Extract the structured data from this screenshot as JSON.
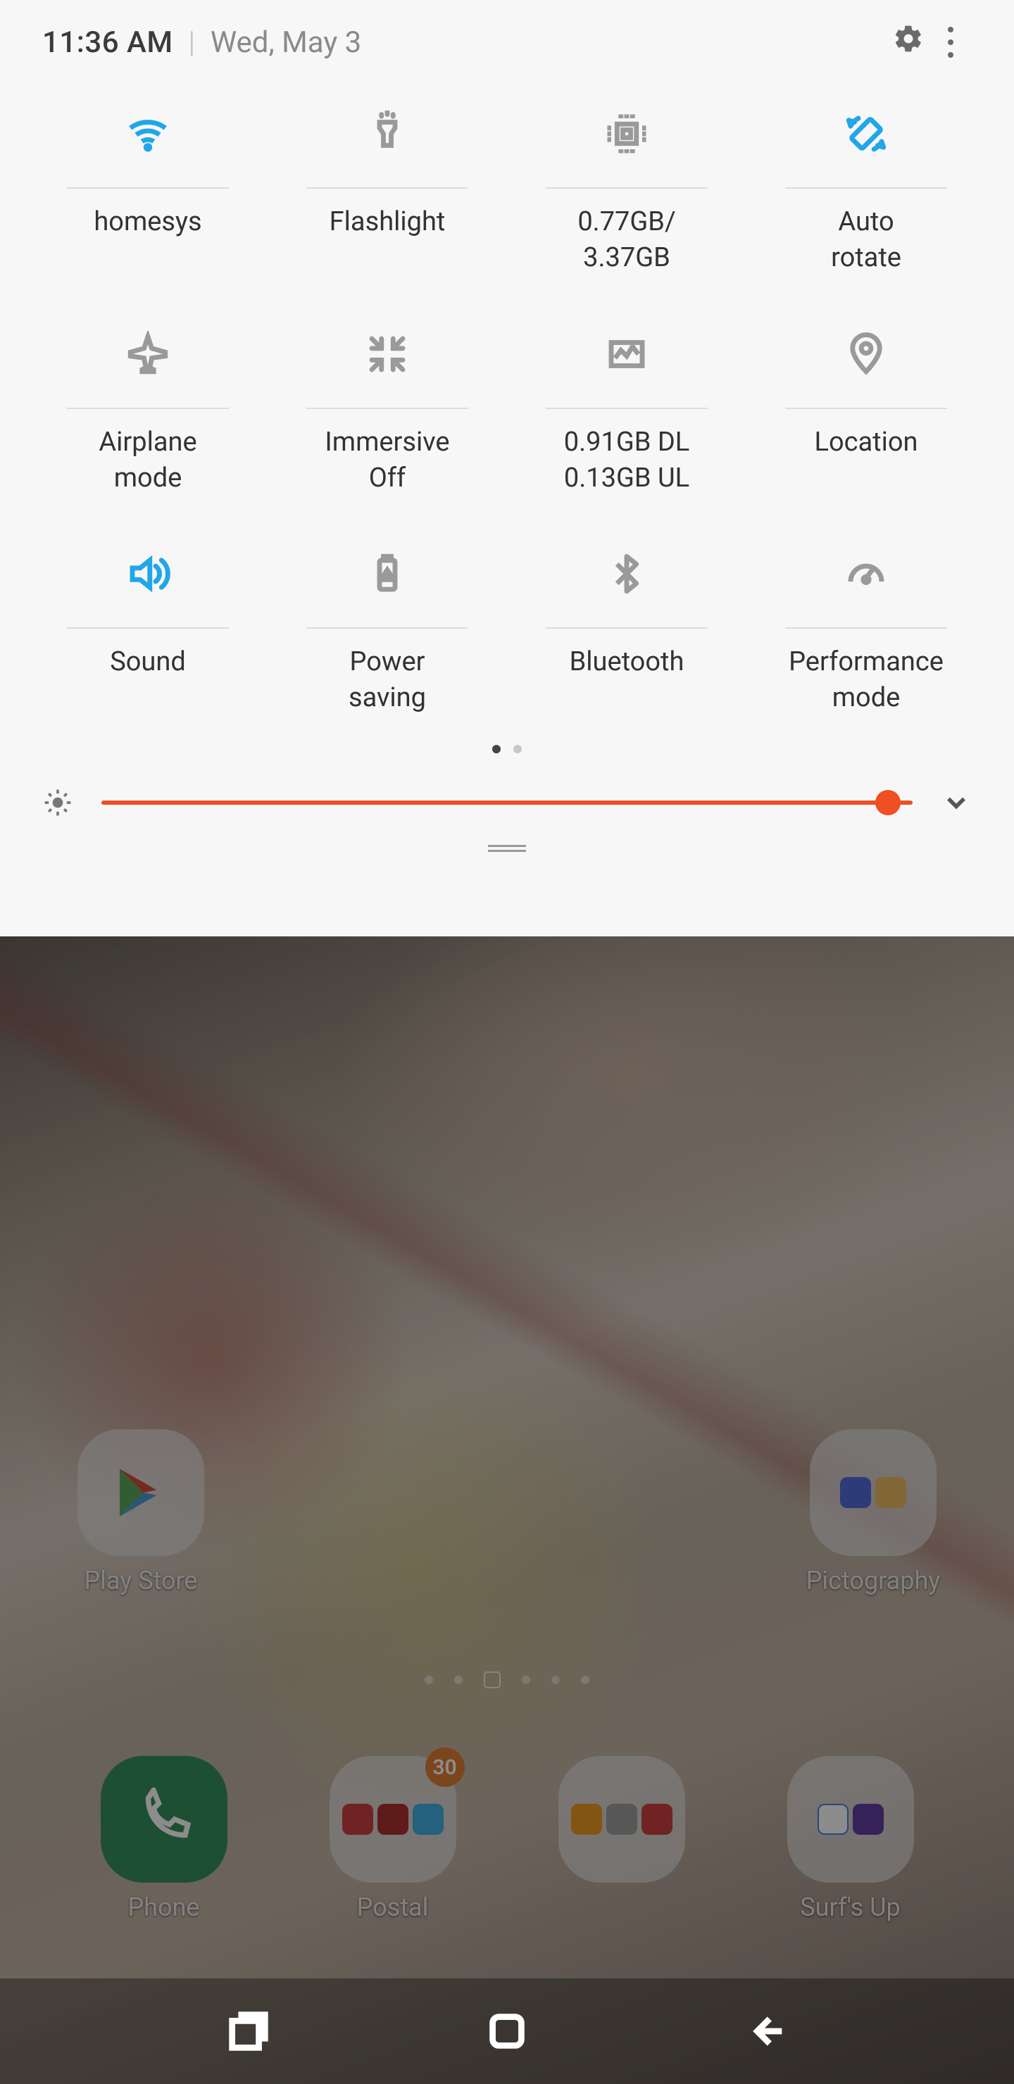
{
  "status": {
    "time": "11:36 AM",
    "date": "Wed, May 3",
    "accent_color": "#21a6e8",
    "slider_color": "#f04e23"
  },
  "tiles": [
    {
      "id": "wifi",
      "label": "homesys",
      "sublabel": "",
      "active": true
    },
    {
      "id": "flashlight",
      "label": "Flashlight",
      "sublabel": "",
      "active": false
    },
    {
      "id": "memory",
      "label": "0.77GB/",
      "sublabel": "3.37GB",
      "active": false
    },
    {
      "id": "autorotate",
      "label": "Auto",
      "sublabel": "rotate",
      "active": true
    },
    {
      "id": "airplane",
      "label": "Airplane",
      "sublabel": "mode",
      "active": false
    },
    {
      "id": "immersive",
      "label": "Immersive",
      "sublabel": "Off",
      "active": false
    },
    {
      "id": "data",
      "label": "0.91GB DL",
      "sublabel": "0.13GB UL",
      "active": false
    },
    {
      "id": "location",
      "label": "Location",
      "sublabel": "",
      "active": false
    },
    {
      "id": "sound",
      "label": "Sound",
      "sublabel": "",
      "active": true
    },
    {
      "id": "powersaving",
      "label": "Power",
      "sublabel": "saving",
      "active": false
    },
    {
      "id": "bluetooth",
      "label": "Bluetooth",
      "sublabel": "",
      "active": false
    },
    {
      "id": "performance",
      "label": "Performance",
      "sublabel": "mode",
      "active": false
    }
  ],
  "pager": {
    "current": 0,
    "total": 2
  },
  "brightness": {
    "value": 0.97
  },
  "home_apps_row1": [
    {
      "label": "Play Store"
    },
    {
      "label": "Pictography"
    }
  ],
  "dock_apps": [
    {
      "label": "Phone"
    },
    {
      "label": "Postal",
      "badge": "30"
    },
    {
      "label": "",
      "note": "badge-grid-folder"
    },
    {
      "label": "Surf's Up"
    }
  ]
}
